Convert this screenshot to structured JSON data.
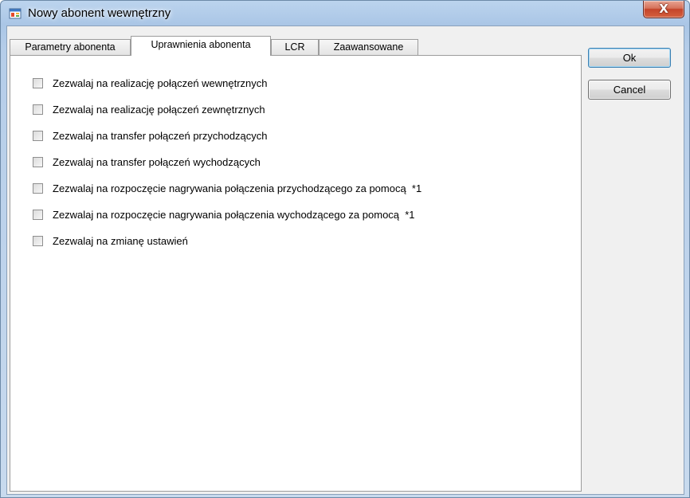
{
  "window": {
    "title": "Nowy abonent wewnętrzny",
    "close_label": "X"
  },
  "tabs": [
    {
      "label": "Parametry abonenta",
      "active": false
    },
    {
      "label": "Uprawnienia abonenta",
      "active": true
    },
    {
      "label": "LCR",
      "active": false
    },
    {
      "label": "Zaawansowane",
      "active": false
    }
  ],
  "permissions": [
    {
      "label": "Zezwalaj na realizację połączeń wewnętrznych",
      "checked": false
    },
    {
      "label": "Zezwalaj na realizację połączeń zewnętrznych",
      "checked": false
    },
    {
      "label": "Zezwalaj na transfer połączeń przychodzących",
      "checked": false
    },
    {
      "label": "Zezwalaj na transfer połączeń wychodzących",
      "checked": false
    },
    {
      "label": "Zezwalaj na rozpoczęcie nagrywania połączenia przychodzącego za pomocą  *1",
      "checked": false
    },
    {
      "label": "Zezwalaj na rozpoczęcie nagrywania połączenia wychodzącego za pomocą  *1",
      "checked": false
    },
    {
      "label": "Zezwalaj na zmianę ustawień",
      "checked": false
    }
  ],
  "buttons": {
    "ok_label": "Ok",
    "cancel_label": "Cancel"
  }
}
